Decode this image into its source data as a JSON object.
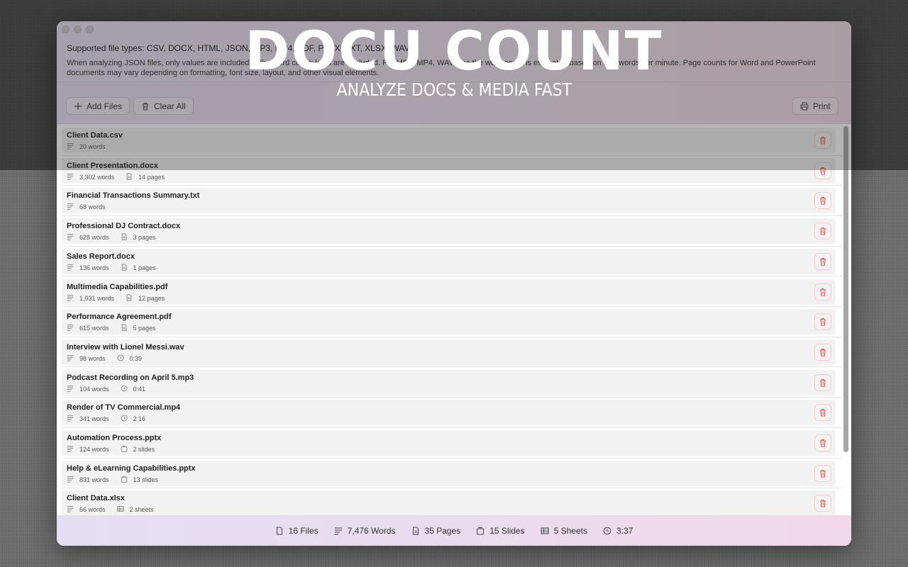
{
  "promo": {
    "title": "DOCU COUNT",
    "subtitle": "ANALYZE DOCS & MEDIA FAST"
  },
  "header": {
    "supported": "Supported file types: CSV, DOCX, HTML, JSON, MP3, MP4, PDF, PPTX, TXT, XLSX, WAV.",
    "note": "When analyzing JSON files, only values are included in the word count; keys are excluded. For MP3, MP4, WAV files the word count is estimated based on 150 words per minute. Page counts for Word and PowerPoint documents may vary depending on formatting, font size, layout, and other visual elements."
  },
  "toolbar": {
    "add_label": "Add Files",
    "clear_label": "Clear All",
    "print_label": "Print"
  },
  "files": [
    {
      "name": "Client Data.csv",
      "words": "20 words"
    },
    {
      "name": "Client Presentation.docx",
      "words": "3,302 words",
      "extra_icon": "page-icon",
      "extra": "14 pages"
    },
    {
      "name": "Financial Transactions Summary.txt",
      "words": "68 words"
    },
    {
      "name": "Professional DJ Contract.docx",
      "words": "628 words",
      "extra_icon": "page-icon",
      "extra": "3 pages"
    },
    {
      "name": "Sales Report.docx",
      "words": "136 words",
      "extra_icon": "page-icon",
      "extra": "1 pages"
    },
    {
      "name": "Multimedia Capabilities.pdf",
      "words": "1,031 words",
      "extra_icon": "page-icon",
      "extra": "12 pages"
    },
    {
      "name": "Performance Agreement.pdf",
      "words": "615 words",
      "extra_icon": "page-icon",
      "extra": "5 pages"
    },
    {
      "name": "Interview with Lionel Messi.wav",
      "words": "98 words",
      "extra_icon": "clock-icon",
      "extra": "0:39"
    },
    {
      "name": "Podcast Recording on April 5.mp3",
      "words": "104 words",
      "extra_icon": "clock-icon",
      "extra": "0:41"
    },
    {
      "name": "Render of TV Commercial.mp4",
      "words": "341 words",
      "extra_icon": "clock-icon",
      "extra": "2:16"
    },
    {
      "name": "Automation Process.pptx",
      "words": "124 words",
      "extra_icon": "slides-icon",
      "extra": "2 slides"
    },
    {
      "name": "Help & eLearning Capabilities.pptx",
      "words": "831 words",
      "extra_icon": "slides-icon",
      "extra": "13 slides"
    },
    {
      "name": "Client Data.xlsx",
      "words": "66 words",
      "extra_icon": "table-icon",
      "extra": "2 sheets"
    }
  ],
  "footer": {
    "files": "16 Files",
    "words": "7,476 Words",
    "pages": "35 Pages",
    "slides": "15 Slides",
    "sheets": "5 Sheets",
    "duration": "3:37"
  },
  "colors": {
    "accent_red": "#e05555",
    "header_tint": "#ece0f2",
    "row_bg": "#f2f2f2"
  }
}
